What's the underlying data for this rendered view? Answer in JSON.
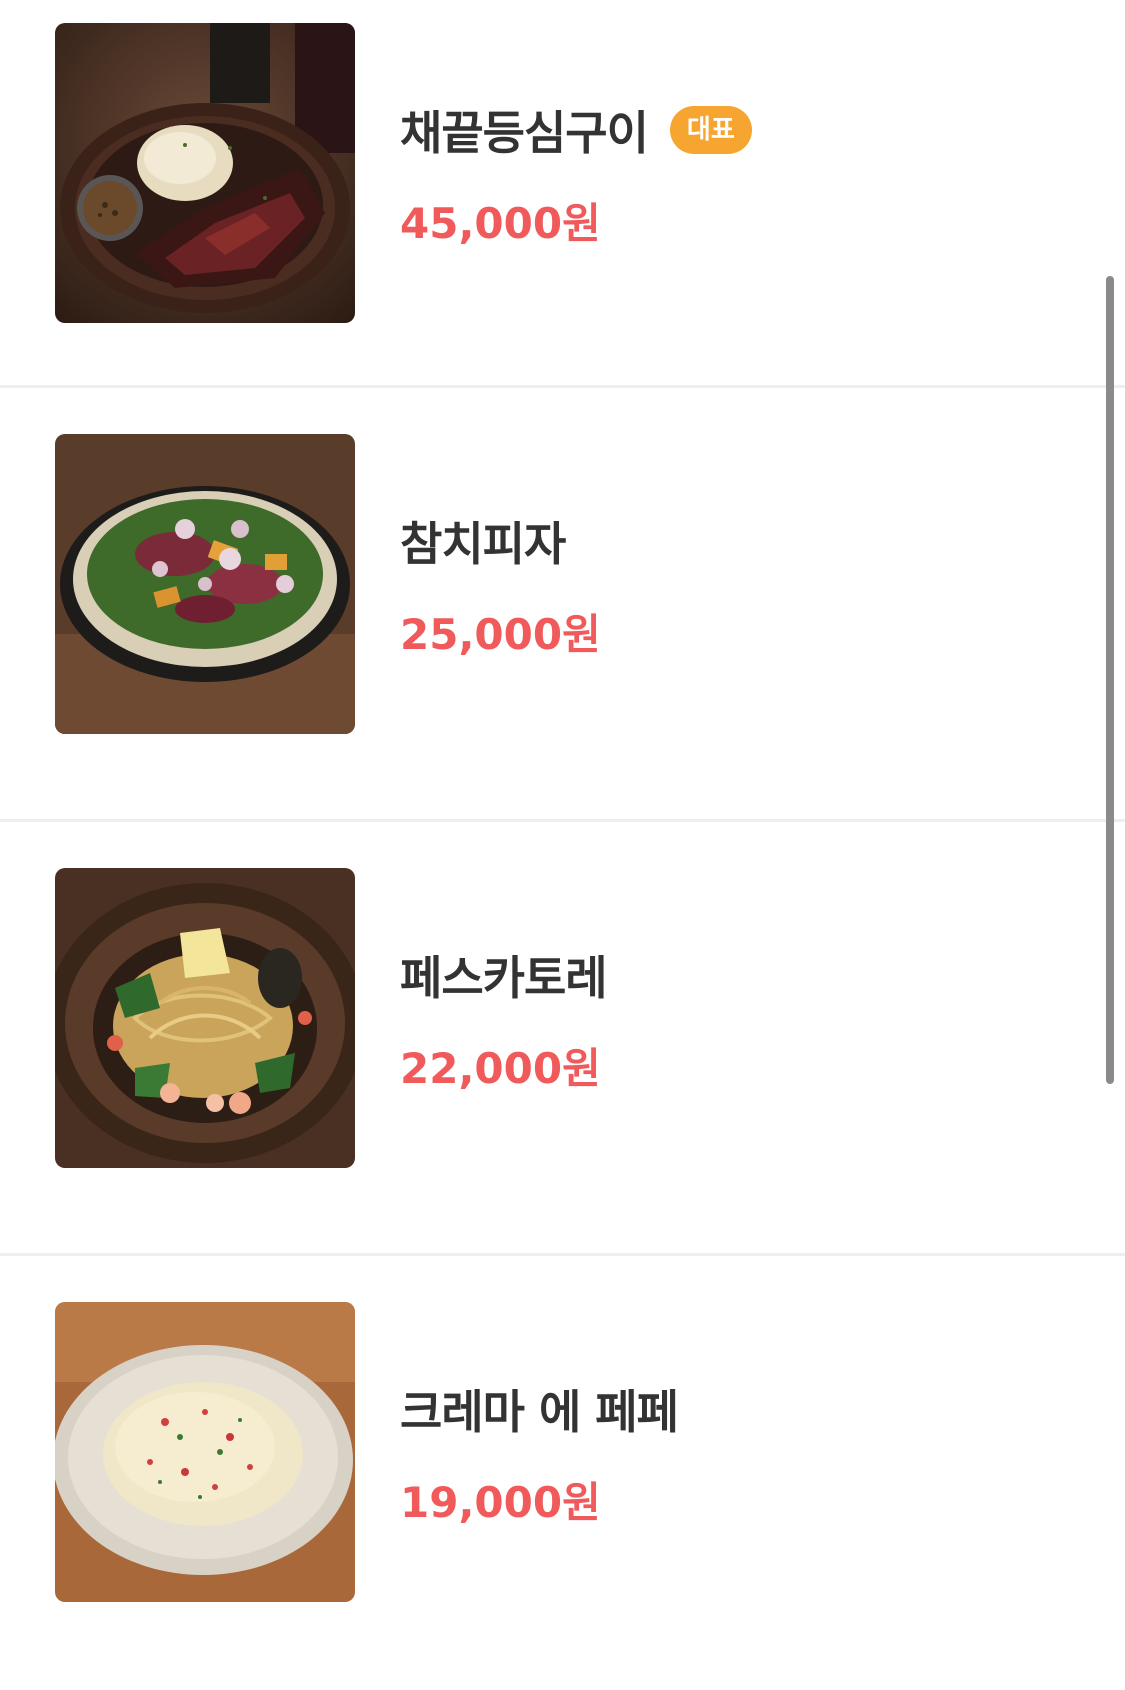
{
  "menu": {
    "items": [
      {
        "name": "채끝등심구이",
        "badge": "대표",
        "price": "45,000원",
        "image_icon": "steak-photo"
      },
      {
        "name": "참치피자",
        "price": "25,000원",
        "image_icon": "tuna-pizza-photo"
      },
      {
        "name": "페스카토레",
        "price": "22,000원",
        "image_icon": "pasta-photo"
      },
      {
        "name": "크레마 에 페페",
        "price": "19,000원",
        "image_icon": "cream-pasta-photo"
      }
    ]
  },
  "colors": {
    "price": "#F15A5A",
    "badge": "#F7A531",
    "name": "#333333",
    "divider": "#EEEEEE"
  }
}
